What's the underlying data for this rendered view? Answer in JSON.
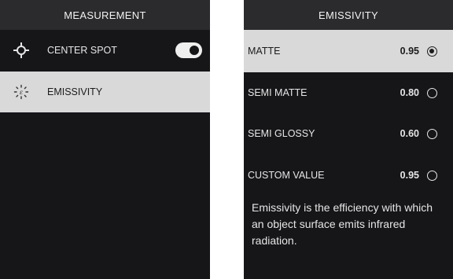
{
  "left_panel": {
    "title": "MEASUREMENT",
    "items": [
      {
        "label": "CENTER SPOT",
        "icon": "crosshair-icon",
        "toggle_on": true
      },
      {
        "label": "EMISSIVITY",
        "icon": "emissivity-icon",
        "selected": true
      }
    ]
  },
  "right_panel": {
    "title": "EMISSIVITY",
    "options": [
      {
        "label": "MATTE",
        "value": "0.95",
        "selected": true
      },
      {
        "label": "SEMI MATTE",
        "value": "0.80",
        "selected": false
      },
      {
        "label": "SEMI GLOSSY",
        "value": "0.60",
        "selected": false
      },
      {
        "label": "CUSTOM VALUE",
        "value": "0.95",
        "selected": false
      }
    ],
    "description": "Emissivity is the efficiency with which an object surface emits infrared radiation."
  },
  "colors": {
    "background": "#161619",
    "header": "#2b2b2e",
    "selected_row": "#d9d9d9"
  }
}
